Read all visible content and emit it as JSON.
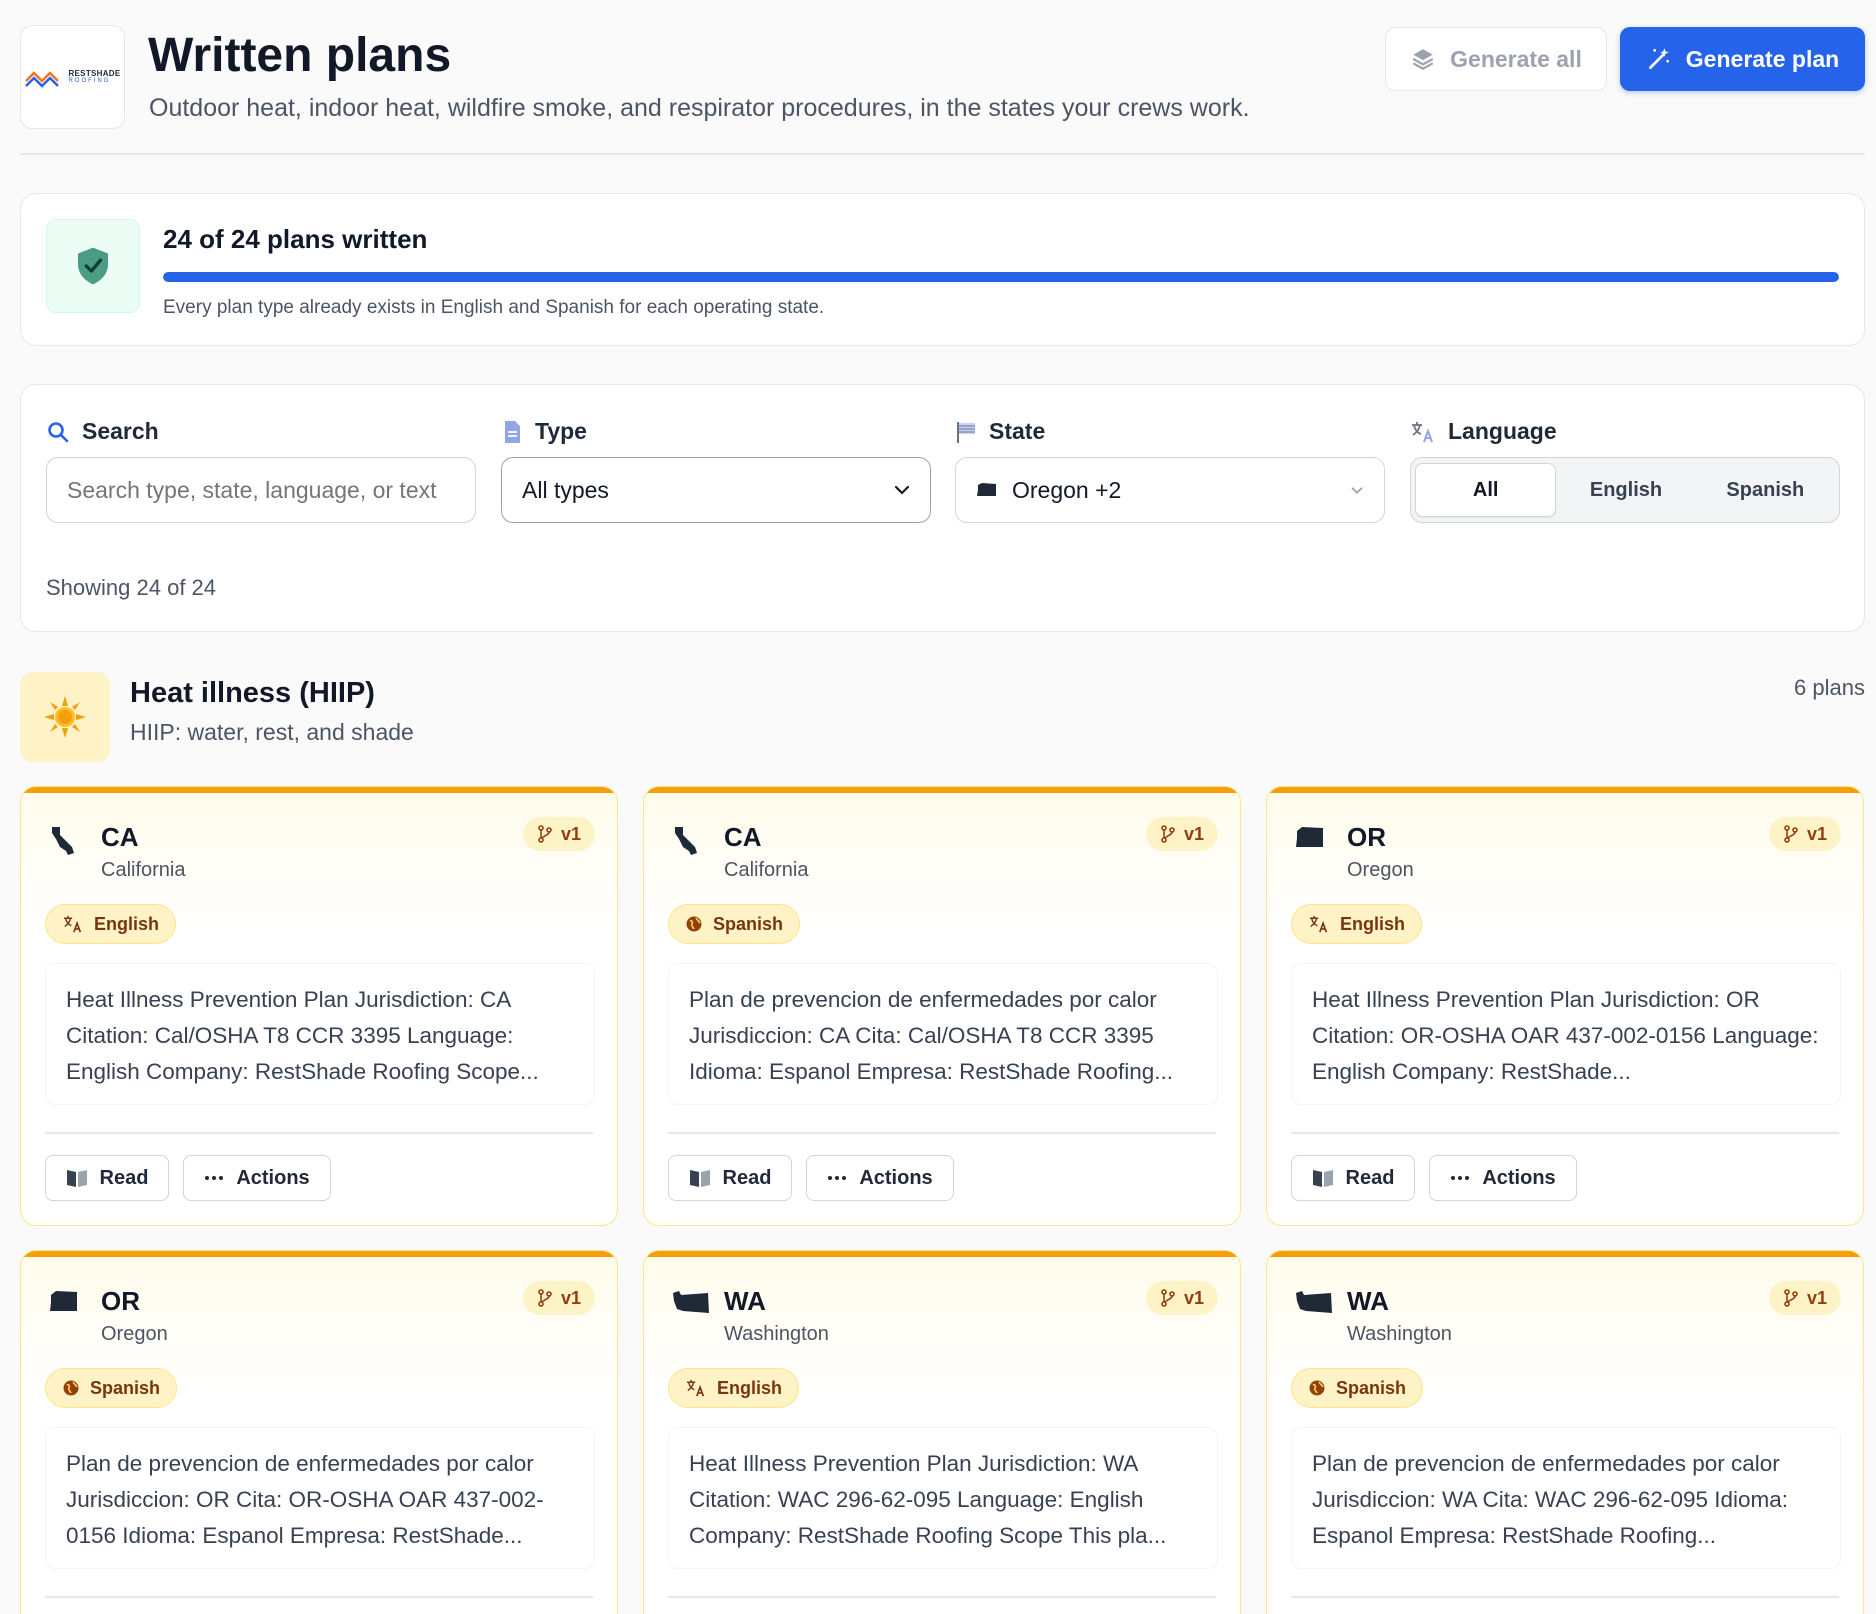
{
  "header": {
    "logo_name": "RESTSHADE",
    "logo_sub": "ROOFING",
    "title": "Written plans",
    "subtitle": "Outdoor heat, indoor heat, wildfire smoke, and respirator procedures, in the states your crews work.",
    "generate_all_label": "Generate all",
    "generate_plan_label": "Generate plan"
  },
  "progress": {
    "title": "24 of 24 plans written",
    "fraction": 1.0,
    "note": "Every plan type already exists in English and Spanish for each operating state."
  },
  "filters": {
    "search": {
      "label": "Search",
      "placeholder": "Search type, state, language, or text"
    },
    "type": {
      "label": "Type",
      "value": "All types"
    },
    "state": {
      "label": "State",
      "value": "Oregon +2"
    },
    "language": {
      "label": "Language",
      "options": [
        "All",
        "English",
        "Spanish"
      ],
      "selected": "All"
    },
    "showing": "Showing 24 of 24"
  },
  "section": {
    "title": "Heat illness (HIIP)",
    "subtitle": "HIIP: water, rest, and shade",
    "count": "6 plans"
  },
  "card_labels": {
    "read": "Read",
    "actions": "Actions"
  },
  "plans": [
    {
      "code": "CA",
      "state": "California",
      "version": "v1",
      "language": "English",
      "excerpt": "Heat Illness Prevention Plan Jurisdiction: CA Citation: Cal/OSHA T8 CCR 3395 Language: English Company: RestShade Roofing Scope..."
    },
    {
      "code": "CA",
      "state": "California",
      "version": "v1",
      "language": "Spanish",
      "excerpt": "Plan de prevencion de enfermedades por calor Jurisdiccion: CA Cita: Cal/OSHA T8 CCR 3395 Idioma: Espanol Empresa: RestShade Roofing..."
    },
    {
      "code": "OR",
      "state": "Oregon",
      "version": "v1",
      "language": "English",
      "excerpt": "Heat Illness Prevention Plan Jurisdiction: OR Citation: OR-OSHA OAR 437-002-0156 Language: English Company: RestShade..."
    },
    {
      "code": "OR",
      "state": "Oregon",
      "version": "v1",
      "language": "Spanish",
      "excerpt": "Plan de prevencion de enfermedades por calor Jurisdiccion: OR Cita: OR-OSHA OAR 437-002-0156 Idioma: Espanol Empresa: RestShade..."
    },
    {
      "code": "WA",
      "state": "Washington",
      "version": "v1",
      "language": "English",
      "excerpt": "Heat Illness Prevention Plan Jurisdiction: WA Citation: WAC 296-62-095 Language: English Company: RestShade Roofing Scope This pla..."
    },
    {
      "code": "WA",
      "state": "Washington",
      "version": "v1",
      "language": "Spanish",
      "excerpt": "Plan de prevencion de enfermedades por calor Jurisdiccion: WA Cita: WAC 296-62-095 Idioma: Espanol Empresa: RestShade Roofing..."
    }
  ],
  "colors": {
    "accent": "#2563eb",
    "heat": "#f59e0b",
    "heat_bg": "#fef3c7",
    "success_bg": "#ecfdf5"
  }
}
